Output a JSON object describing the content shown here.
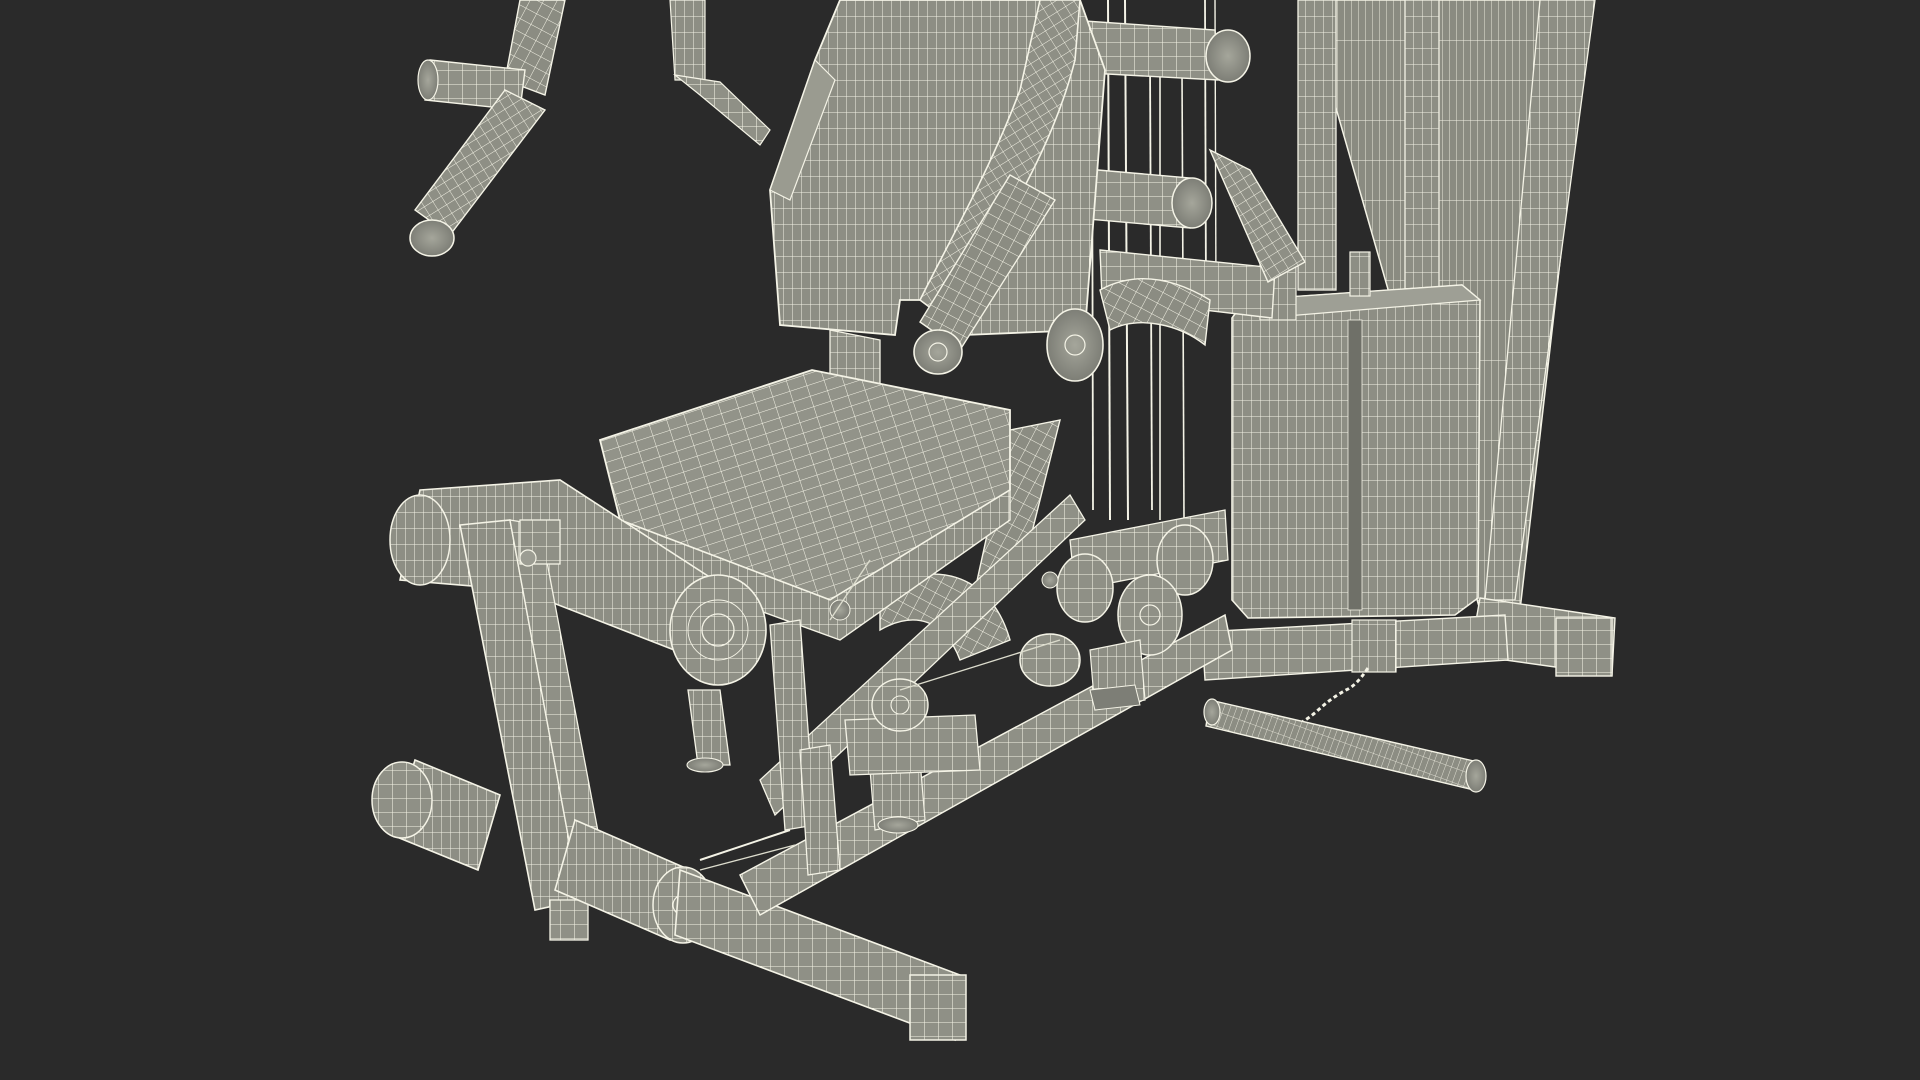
{
  "colors": {
    "background": "#2a2a2a",
    "surface": "#8f9086",
    "surface_light": "#a6a79c",
    "surface_dark": "#6f7068",
    "wire": "#f4f3e6",
    "wire_faint": "#dcdccd"
  },
  "subject": {
    "icon": "home-gym-wireframe-icon"
  }
}
